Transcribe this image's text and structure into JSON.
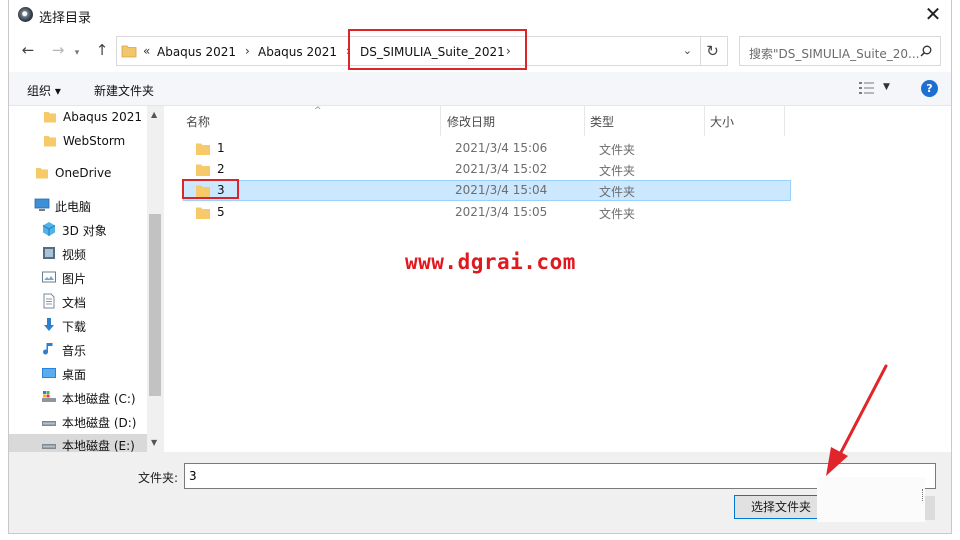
{
  "window": {
    "title": "选择目录"
  },
  "address_bar": {
    "overflow": "«",
    "crumbs": [
      "Abaqus 2021",
      "Abaqus 2021",
      "DS_SIMULIA_Suite_2021"
    ],
    "highlight_color": "#d9262b"
  },
  "search": {
    "placeholder": "搜索\"DS_SIMULIA_Suite_20..."
  },
  "toolbar": {
    "organize_label": "组织 ▾",
    "new_folder_label": "新建文件夹",
    "help_label": "?"
  },
  "nav_tree": {
    "items": [
      {
        "label": "Abaqus 2021",
        "icon": "folder-icon"
      },
      {
        "label": "WebStorm",
        "icon": "folder-icon"
      },
      {
        "label": "OneDrive",
        "icon": "folder-icon"
      },
      {
        "label": "此电脑",
        "icon": "computer-icon"
      },
      {
        "label": "3D 对象",
        "icon": "3d-objects-icon"
      },
      {
        "label": "视频",
        "icon": "video-icon"
      },
      {
        "label": "图片",
        "icon": "pictures-icon"
      },
      {
        "label": "文档",
        "icon": "documents-icon"
      },
      {
        "label": "下载",
        "icon": "download-icon"
      },
      {
        "label": "音乐",
        "icon": "music-icon"
      },
      {
        "label": "桌面",
        "icon": "desktop-icon"
      },
      {
        "label": "本地磁盘 (C:)",
        "icon": "drive-c-icon"
      },
      {
        "label": "本地磁盘 (D:)",
        "icon": "drive-icon"
      },
      {
        "label": "本地磁盘 (E:)",
        "icon": "drive-icon",
        "selected": true
      }
    ]
  },
  "file_list": {
    "columns": [
      "名称",
      "修改日期",
      "类型",
      "大小"
    ],
    "rows": [
      {
        "name": "1",
        "date": "2021/3/4 15:06",
        "type": "文件夹"
      },
      {
        "name": "2",
        "date": "2021/3/4 15:02",
        "type": "文件夹"
      },
      {
        "name": "3",
        "date": "2021/3/4 15:04",
        "type": "文件夹",
        "selected": true
      },
      {
        "name": "5",
        "date": "2021/3/4 15:05",
        "type": "文件夹"
      }
    ]
  },
  "watermark": "www.dgrai.com",
  "footer": {
    "folder_label": "文件夹:",
    "folder_value": "3",
    "select_button": "选择文件夹"
  },
  "colors": {
    "selection": "#cce8ff",
    "accent": "#0078d7",
    "annotation": "#d9262b"
  }
}
